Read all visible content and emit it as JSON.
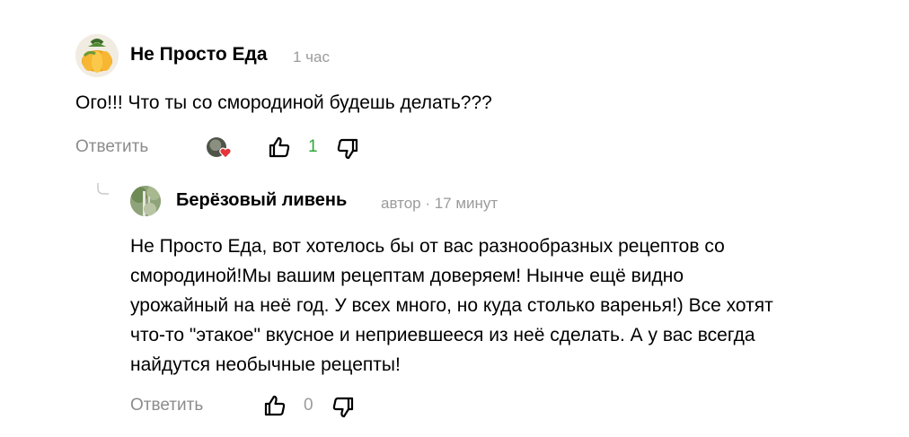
{
  "comments": [
    {
      "author": "Не Просто Еда",
      "time": "1 час",
      "text": "Ого!!! Что ты со смородиной будешь делать???",
      "reply_label": "Ответить",
      "likes": "1",
      "like_color": "#2fa83a",
      "reaction_icon": "heart-icon"
    }
  ],
  "reply": {
    "author": "Берёзовый ливень",
    "meta": "автор · 17 минут",
    "lines": [
      "Не Просто Еда, вот хотелось бы от вас разнообразных рецептов со",
      "смородиной!Мы вашим рецептам доверяем! Нынче ещё видно",
      "урожайный на неё год. У всех много, но куда столько варенья!) Все хотят",
      "что-то \"этакое\" вкусное и неприевшееся из неё сделать. А у вас всегда",
      "найдутся необычные рецепты!"
    ],
    "reply_label": "Ответить",
    "likes": "0"
  },
  "colors": {
    "secondary_text": "#8c8c8c",
    "like_active": "#2fa83a",
    "heart": "#e5343a"
  }
}
